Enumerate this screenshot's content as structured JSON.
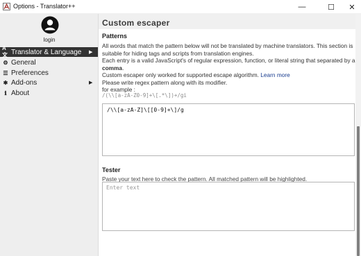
{
  "window": {
    "title": "Options - Translator++",
    "minimize_glyph": "—",
    "maximize_glyph": "☐",
    "close_glyph": "✕"
  },
  "sidebar": {
    "login_label": "login",
    "items": [
      {
        "label": "Translator & Language",
        "icon": "translate-icon",
        "glyph": "A文",
        "has_arrow": true,
        "active": true
      },
      {
        "label": "General",
        "icon": "gear-icon",
        "glyph": "⚙",
        "has_arrow": false,
        "active": false
      },
      {
        "label": "Preferences",
        "icon": "list-icon",
        "glyph": "☰",
        "has_arrow": false,
        "active": false
      },
      {
        "label": "Add-ons",
        "icon": "puzzle-icon",
        "glyph": "✱",
        "has_arrow": true,
        "active": false
      },
      {
        "label": "About",
        "icon": "info-icon",
        "glyph": "ℹ",
        "has_arrow": false,
        "active": false
      }
    ],
    "arrow_glyph": "▶"
  },
  "main": {
    "section_title": "Custom escaper",
    "patterns_heading": "Patterns",
    "desc_line1": "All words that match the pattern below will not be translated by machine translators. This section is",
    "desc_line2": "suitable for hiding tags and scripts from translation engines.",
    "desc_line3": "Each entry is a valid JavaScript's of regular expression, function, or literal string that separated by a",
    "desc_line4_bold": "comma",
    "desc_line4_end": ".",
    "desc_line5": "Custom escaper only worked for supported escape algorithm.",
    "learn_more": "Learn more",
    "desc_line6": "Please write regex pattern along with its modifier.",
    "desc_line7": "for example :",
    "example_code": "/(\\\\[a-zA-Z0-9]+\\[.*\\])+/gi",
    "pattern_value": "/\\\\[a-zA-Z]\\[[0-9]+\\]/g",
    "tester_heading": "Tester",
    "tester_desc": "Paste your text here to check the pattern. All matched pattern will be highlighted.",
    "tester_placeholder": "Enter text"
  },
  "colors": {
    "active_nav_bg": "#333333",
    "sidebar_bg": "#eeeeee",
    "link": "#1a3d8f",
    "scroll_thumb": "#808080"
  }
}
